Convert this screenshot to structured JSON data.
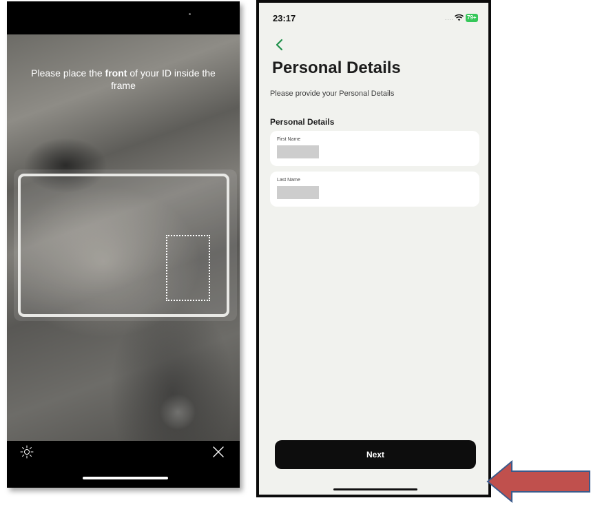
{
  "left_screen": {
    "instruction_before": "Please place the ",
    "instruction_bold": "front",
    "instruction_after": " of your ID inside the frame",
    "flash_icon": "sun-icon",
    "close_icon": "close-icon"
  },
  "right_screen": {
    "status": {
      "time": "23:17",
      "signal": "....",
      "wifi_icon": "wifi-icon",
      "battery": "79+"
    },
    "back_icon": "chevron-left-icon",
    "title": "Personal Details",
    "subtitle": "Please provide your Personal Details",
    "section_heading": "Personal Details",
    "fields": [
      {
        "label": "First Name"
      },
      {
        "label": "Last Name"
      }
    ],
    "next_label": "Next"
  },
  "colors": {
    "accent_green": "#1f8f4a",
    "battery_green": "#35c759",
    "button_black": "#0d0d0d",
    "arrow_fill": "#c0504d",
    "arrow_border": "#3b5a8a"
  }
}
